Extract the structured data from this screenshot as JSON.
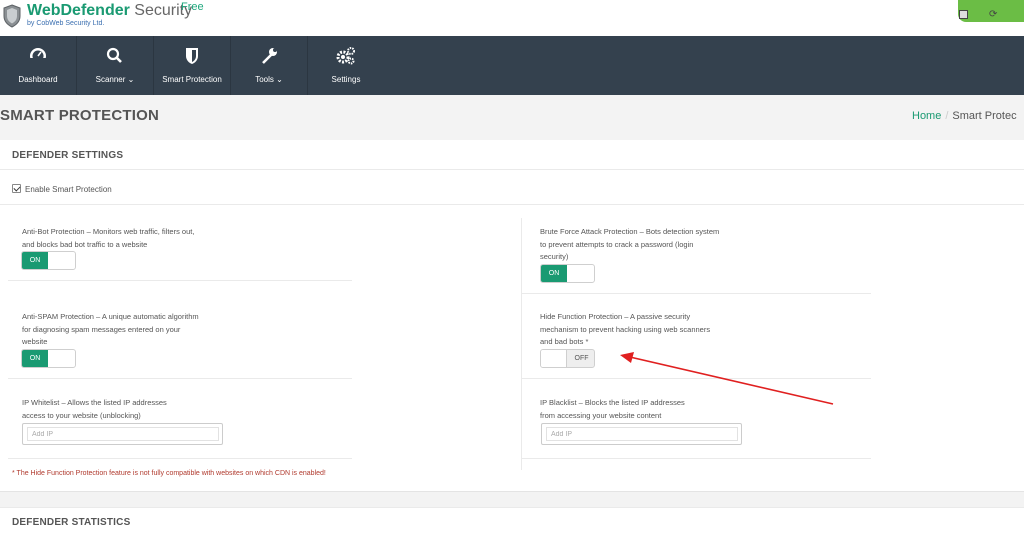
{
  "header": {
    "brand_name": "WebDefender",
    "brand_suffix": "Security",
    "brand_badge": "Free",
    "brand_sub": "by CobWeb Security Ltd.",
    "accent_color": "#1a9a72"
  },
  "nav": {
    "items": [
      {
        "label": "Dashboard",
        "icon": "dashboard-gauge-icon"
      },
      {
        "label": "Scanner",
        "icon": "search-icon"
      },
      {
        "label": "Smart Protection",
        "icon": "shield-icon"
      },
      {
        "label": "Tools",
        "icon": "wrench-icon"
      },
      {
        "label": "Settings",
        "icon": "gears-icon"
      }
    ]
  },
  "page": {
    "title": "SMART PROTECTION",
    "breadcrumb_home": "Home",
    "breadcrumb_sep": "/",
    "breadcrumb_current": "Smart Protec"
  },
  "settings": {
    "panel_title": "DEFENDER SETTINGS",
    "enable_label": "Enable Smart Protection",
    "enable_checked": true,
    "antibot": {
      "line1": "Anti-Bot Protection – Monitors web traffic, filters out,",
      "line2": "and blocks bad bot traffic to a website",
      "toggle": "ON"
    },
    "bruteforce": {
      "line1": "Brute Force Attack Protection – Bots detection system",
      "line2": "to prevent attempts to crack a password (login",
      "line3": "security)",
      "toggle": "ON"
    },
    "antispam": {
      "line1": "Anti-SPAM Protection – A unique automatic algorithm",
      "line2": "for diagnosing spam messages entered on your",
      "line3": "website",
      "toggle": "ON"
    },
    "hidefunc": {
      "line1": "Hide Function Protection – A passive security",
      "line2": "mechanism to prevent hacking using web scanners",
      "line3": "and bad bots",
      "asterisk": "*",
      "toggle": "OFF"
    },
    "whitelist": {
      "line1": "IP Whitelist – Allows the listed IP addresses",
      "line2": "access to your website (unblocking)",
      "placeholder": "Add IP"
    },
    "blacklist": {
      "line1": "IP Blacklist – Blocks the listed IP addresses",
      "line2": "from accessing your website content",
      "placeholder": "Add IP"
    },
    "note": "* The Hide Function Protection feature is not fully compatible with websites on which CDN is enabled!"
  },
  "stats": {
    "panel_title": "DEFENDER STATISTICS"
  }
}
